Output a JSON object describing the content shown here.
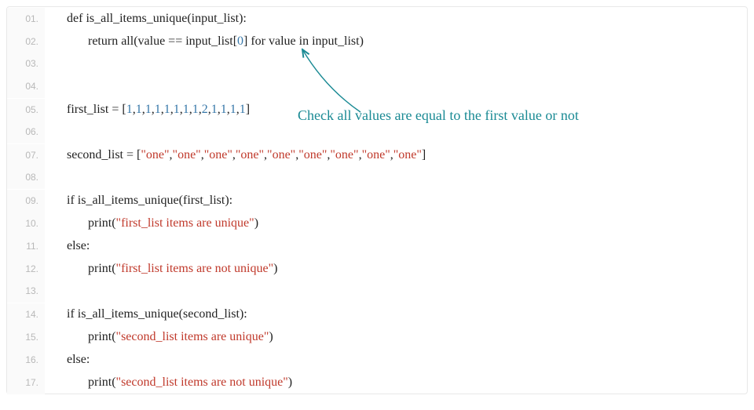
{
  "annotation": "Check all values are equal to the first value or not",
  "lines": [
    {
      "num": "01.",
      "indent": 0,
      "tokens": [
        {
          "t": "def ",
          "c": "kw"
        },
        {
          "t": "is_all_items_unique",
          "c": "fn"
        },
        {
          "t": "(input_list):",
          "c": "paren"
        }
      ]
    },
    {
      "num": "02.",
      "indent": 1,
      "tokens": [
        {
          "t": "return ",
          "c": "kw"
        },
        {
          "t": "all(value ",
          "c": "var"
        },
        {
          "t": "=",
          "c": "op"
        },
        {
          "t": "=",
          "c": "op"
        },
        {
          "t": " input_list[",
          "c": "var"
        },
        {
          "t": "0",
          "c": "num"
        },
        {
          "t": "] ",
          "c": "var"
        },
        {
          "t": "for ",
          "c": "kw"
        },
        {
          "t": "value ",
          "c": "var"
        },
        {
          "t": "in ",
          "c": "kw"
        },
        {
          "t": "input_list)",
          "c": "var"
        }
      ]
    },
    {
      "num": "03.",
      "indent": 0,
      "tokens": []
    },
    {
      "num": "04.",
      "indent": 0,
      "tokens": []
    },
    {
      "num": "05.",
      "indent": 0,
      "tokens": [
        {
          "t": "first_list ",
          "c": "var"
        },
        {
          "t": "=",
          "c": "op"
        },
        {
          "t": " [",
          "c": "paren"
        },
        {
          "t": "1",
          "c": "num"
        },
        {
          "t": ",",
          "c": "paren"
        },
        {
          "t": "1",
          "c": "num"
        },
        {
          "t": ",",
          "c": "paren"
        },
        {
          "t": "1",
          "c": "num"
        },
        {
          "t": ",",
          "c": "paren"
        },
        {
          "t": "1",
          "c": "num"
        },
        {
          "t": ",",
          "c": "paren"
        },
        {
          "t": "1",
          "c": "num"
        },
        {
          "t": ",",
          "c": "paren"
        },
        {
          "t": "1",
          "c": "num"
        },
        {
          "t": ",",
          "c": "paren"
        },
        {
          "t": "1",
          "c": "num"
        },
        {
          "t": ",",
          "c": "paren"
        },
        {
          "t": "1",
          "c": "num"
        },
        {
          "t": ",",
          "c": "paren"
        },
        {
          "t": "2",
          "c": "num"
        },
        {
          "t": ",",
          "c": "paren"
        },
        {
          "t": "1",
          "c": "num"
        },
        {
          "t": ",",
          "c": "paren"
        },
        {
          "t": "1",
          "c": "num"
        },
        {
          "t": ",",
          "c": "paren"
        },
        {
          "t": "1",
          "c": "num"
        },
        {
          "t": ",",
          "c": "paren"
        },
        {
          "t": "1",
          "c": "num"
        },
        {
          "t": "]",
          "c": "paren"
        }
      ]
    },
    {
      "num": "06.",
      "indent": 0,
      "tokens": []
    },
    {
      "num": "07.",
      "indent": 0,
      "tokens": [
        {
          "t": "second_list ",
          "c": "var"
        },
        {
          "t": "=",
          "c": "op"
        },
        {
          "t": " [",
          "c": "paren"
        },
        {
          "t": "\"one\"",
          "c": "str"
        },
        {
          "t": ",",
          "c": "paren"
        },
        {
          "t": "\"one\"",
          "c": "str"
        },
        {
          "t": ",",
          "c": "paren"
        },
        {
          "t": "\"one\"",
          "c": "str"
        },
        {
          "t": ",",
          "c": "paren"
        },
        {
          "t": "\"one\"",
          "c": "str"
        },
        {
          "t": ",",
          "c": "paren"
        },
        {
          "t": "\"one\"",
          "c": "str"
        },
        {
          "t": ",",
          "c": "paren"
        },
        {
          "t": "\"one\"",
          "c": "str"
        },
        {
          "t": ",",
          "c": "paren"
        },
        {
          "t": "\"one\"",
          "c": "str"
        },
        {
          "t": ",",
          "c": "paren"
        },
        {
          "t": "\"one\"",
          "c": "str"
        },
        {
          "t": ",",
          "c": "paren"
        },
        {
          "t": "\"one\"",
          "c": "str"
        },
        {
          "t": "]",
          "c": "paren"
        }
      ]
    },
    {
      "num": "08.",
      "indent": 0,
      "tokens": []
    },
    {
      "num": "09.",
      "indent": 0,
      "tokens": [
        {
          "t": "if ",
          "c": "kw"
        },
        {
          "t": "is_all_items_unique(first_list):",
          "c": "var"
        }
      ]
    },
    {
      "num": "10.",
      "indent": 1,
      "tokens": [
        {
          "t": "print",
          "c": "kw"
        },
        {
          "t": "(",
          "c": "paren"
        },
        {
          "t": "\"first_list items are unique\"",
          "c": "str"
        },
        {
          "t": ")",
          "c": "paren"
        }
      ]
    },
    {
      "num": "11.",
      "indent": 0,
      "tokens": [
        {
          "t": "else",
          "c": "kw"
        },
        {
          "t": ":",
          "c": "paren"
        }
      ]
    },
    {
      "num": "12.",
      "indent": 1,
      "tokens": [
        {
          "t": "print",
          "c": "kw"
        },
        {
          "t": "(",
          "c": "paren"
        },
        {
          "t": "\"first_list items are not unique\"",
          "c": "str"
        },
        {
          "t": ")",
          "c": "paren"
        }
      ]
    },
    {
      "num": "13.",
      "indent": 0,
      "tokens": []
    },
    {
      "num": "14.",
      "indent": 0,
      "tokens": [
        {
          "t": "if ",
          "c": "kw"
        },
        {
          "t": "is_all_items_unique(second_list):",
          "c": "var"
        }
      ]
    },
    {
      "num": "15.",
      "indent": 1,
      "tokens": [
        {
          "t": "print",
          "c": "kw"
        },
        {
          "t": "(",
          "c": "paren"
        },
        {
          "t": "\"second_list items are unique\"",
          "c": "str"
        },
        {
          "t": ")",
          "c": "paren"
        }
      ]
    },
    {
      "num": "16.",
      "indent": 0,
      "tokens": [
        {
          "t": "else",
          "c": "kw"
        },
        {
          "t": ":",
          "c": "paren"
        }
      ]
    },
    {
      "num": "17.",
      "indent": 1,
      "tokens": [
        {
          "t": "print",
          "c": "kw"
        },
        {
          "t": "(",
          "c": "paren"
        },
        {
          "t": "\"second_list items are not unique\"",
          "c": "str"
        },
        {
          "t": ")",
          "c": "paren"
        }
      ]
    }
  ]
}
